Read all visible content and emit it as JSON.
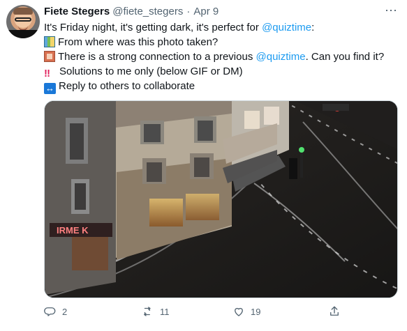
{
  "author": {
    "name": "Fiete Stegers",
    "handle": "@fiete_stegers",
    "date": "Apr 9",
    "avatar_icon": "profile-photo"
  },
  "tweet": {
    "line1_before": "It's Friday night, it's getting dark, it's perfect for ",
    "line1_mention": "@quiztime",
    "line1_after": ":",
    "line2": "From where was this photo taken?",
    "line3_before": "There is a strong connection to a previous ",
    "line3_mention": "@quiztime",
    "line3_after": ". Can you find it?",
    "line4": "Solutions to me only (below GIF or DM)",
    "line5": "Reply to others to collaborate",
    "emoji": {
      "line2": "world-map",
      "line3": "book",
      "line4": "double-exclamation",
      "line5": "left-right-arrow"
    }
  },
  "media": {
    "description_icon": "night-street-photo",
    "shop_sign": "IRME K"
  },
  "actions": {
    "reply_count": "2",
    "retweet_count": "11",
    "like_count": "19",
    "share_icon": "share"
  },
  "colors": {
    "mention": "#1d9bf0",
    "secondary_text": "#536471",
    "border": "#cfd9de"
  },
  "more_icon": "ellipsis"
}
